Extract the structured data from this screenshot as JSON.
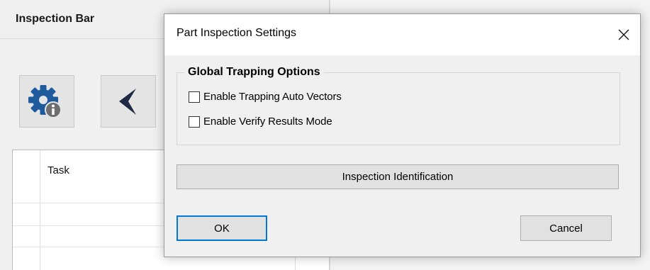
{
  "background": {
    "panel_title": "Inspection Bar",
    "toolbar": [
      {
        "icon": "gear-info-icon"
      },
      {
        "icon": "arrow-pointer-icon"
      }
    ],
    "grid": {
      "columns": [
        "Task"
      ]
    }
  },
  "dialog": {
    "title": "Part Inspection Settings",
    "close_icon": "close-icon",
    "group": {
      "legend": "Global Trapping Options",
      "options": [
        {
          "label": "Enable Trapping Auto Vectors",
          "checked": false
        },
        {
          "label": "Enable Verify Results Mode",
          "checked": false
        }
      ]
    },
    "identification_button": "Inspection Identification",
    "ok_button": "OK",
    "cancel_button": "Cancel"
  },
  "colors": {
    "accent_focus": "#0078d7",
    "gear_icon": "#1e5a9c",
    "info_badge": "#6e6e6e",
    "window_bg": "#f0f0f0"
  }
}
